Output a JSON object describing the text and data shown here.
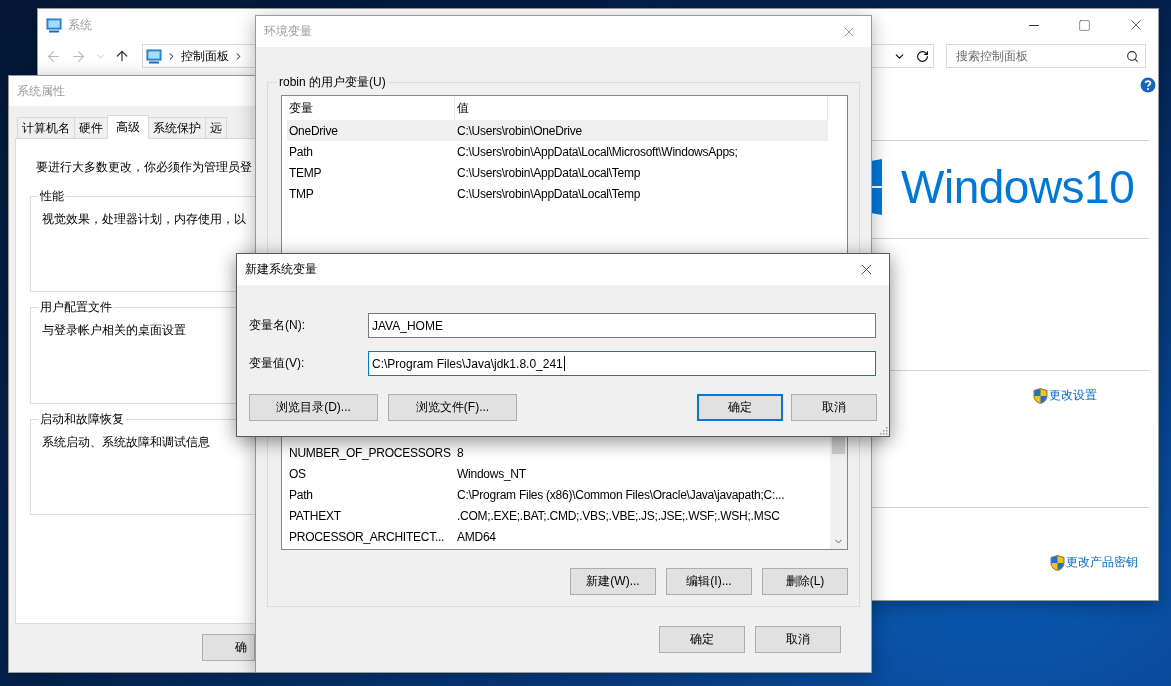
{
  "control_panel": {
    "title": "系统",
    "active": false,
    "breadcrumb": [
      "控制面板"
    ],
    "search": {
      "placeholder": "搜索控制面板"
    },
    "logo": "Windows10",
    "links": [
      "更改设置",
      "更改产品密钥"
    ]
  },
  "system_properties": {
    "title": "系统属性",
    "active": false,
    "tabs": [
      {
        "label": "计算机名",
        "selected": false
      },
      {
        "label": "硬件",
        "selected": false
      },
      {
        "label": "高级",
        "selected": true
      },
      {
        "label": "系统保护",
        "selected": false
      },
      {
        "label": "远",
        "selected": false
      }
    ],
    "notice": "要进行大多数更改，你必须作为管理员登",
    "groups": [
      {
        "title": "性能",
        "text": "视觉效果，处理器计划，内存使用，以"
      },
      {
        "title": "用户配置文件",
        "text": "与登录帐户相关的桌面设置"
      },
      {
        "title": "启动和故障恢复",
        "text": "系统启动、系统故障和调试信息"
      }
    ],
    "buttons": [
      "确"
    ]
  },
  "environment_variables": {
    "title": "环境变量",
    "active": false,
    "user_variables": {
      "title": "robin 的用户变量(U)",
      "columns": [
        "变量",
        "值"
      ],
      "rows": [
        {
          "name": "OneDrive",
          "value": "C:\\Users\\robin\\OneDrive",
          "selected": true
        },
        {
          "name": "Path",
          "value": "C:\\Users\\robin\\AppData\\Local\\Microsoft\\WindowsApps;",
          "selected": false
        },
        {
          "name": "TEMP",
          "value": "C:\\Users\\robin\\AppData\\Local\\Temp",
          "selected": false
        },
        {
          "name": "TMP",
          "value": "C:\\Users\\robin\\AppData\\Local\\Temp",
          "selected": false
        }
      ]
    },
    "system_variables": {
      "rows": [
        {
          "name": "NUMBER_OF_PROCESSORS",
          "value": "8",
          "selected": false
        },
        {
          "name": "OS",
          "value": "Windows_NT",
          "selected": false
        },
        {
          "name": "Path",
          "value": "C:\\Program Files (x86)\\Common Files\\Oracle\\Java\\javapath;C:...",
          "selected": false
        },
        {
          "name": "PATHEXT",
          "value": ".COM;.EXE;.BAT;.CMD;.VBS;.VBE;.JS;.JSE;.WSF;.WSH;.MSC",
          "selected": false
        },
        {
          "name": "PROCESSOR_ARCHITECT...",
          "value": "AMD64",
          "selected": false
        }
      ],
      "buttons": [
        "新建(W)...",
        "编辑(I)...",
        "删除(L)"
      ]
    },
    "buttons": [
      "确定",
      "取消"
    ]
  },
  "new_variable_dialog": {
    "title": "新建系统变量",
    "active": true,
    "fields": [
      {
        "label": "变量名(N):",
        "value": "JAVA_HOME",
        "focused": false
      },
      {
        "label": "变量值(V):",
        "value": "C:\\Program Files\\Java\\jdk1.8.0_241",
        "focused": true
      }
    ],
    "left_buttons": [
      {
        "label": "浏览目录(D)...",
        "default": false
      },
      {
        "label": "浏览文件(F)...",
        "default": false
      }
    ],
    "right_buttons": [
      {
        "label": "确定",
        "default": true
      },
      {
        "label": "取消",
        "default": false
      }
    ]
  }
}
